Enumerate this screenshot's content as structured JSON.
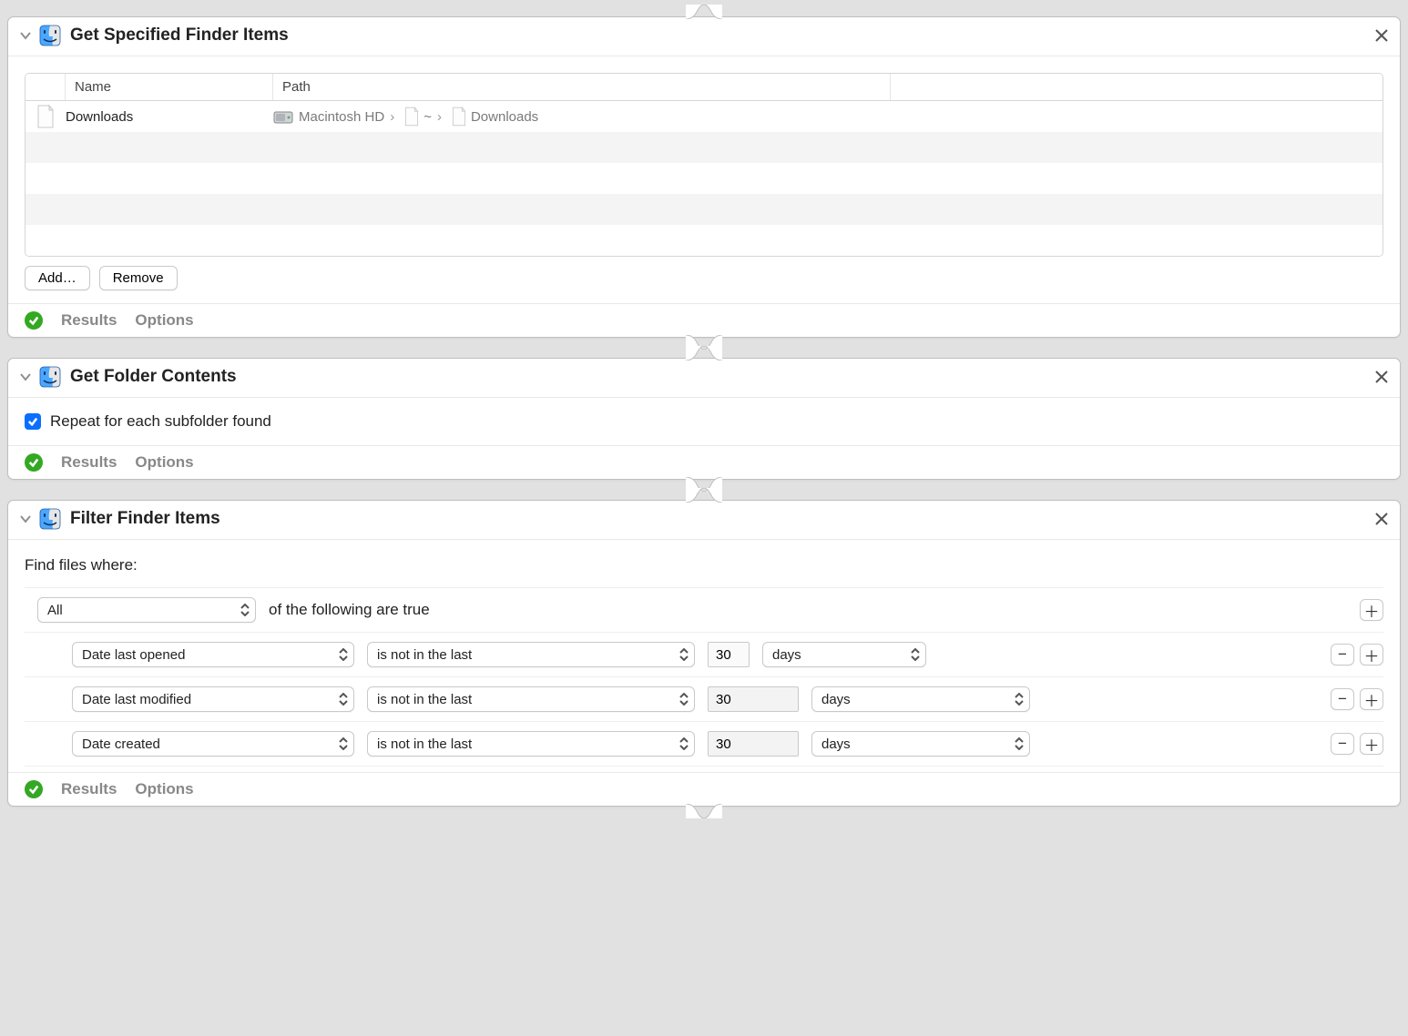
{
  "footer": {
    "results": "Results",
    "options": "Options"
  },
  "block1": {
    "title": "Get Specified Finder Items",
    "columns": {
      "name": "Name",
      "path": "Path"
    },
    "row": {
      "name": "Downloads",
      "drive": "Macintosh HD",
      "seg1": "~",
      "seg2": "Downloads"
    },
    "buttons": {
      "add": "Add…",
      "remove": "Remove"
    }
  },
  "block2": {
    "title": "Get Folder Contents",
    "checkbox_label": "Repeat for each subfolder found"
  },
  "block3": {
    "title": "Filter Finder Items",
    "prefix": "Find files where:",
    "match_selector": "All",
    "match_suffix": "of the following are true",
    "rules": [
      {
        "attr": "Date last opened",
        "op": "is not in the last",
        "value": "30",
        "unit": "days",
        "input_light": true
      },
      {
        "attr": "Date last modified",
        "op": "is not in the last",
        "value": "30",
        "unit": "days",
        "input_light": false
      },
      {
        "attr": "Date created",
        "op": "is not in the last",
        "value": "30",
        "unit": "days",
        "input_light": false
      }
    ]
  }
}
